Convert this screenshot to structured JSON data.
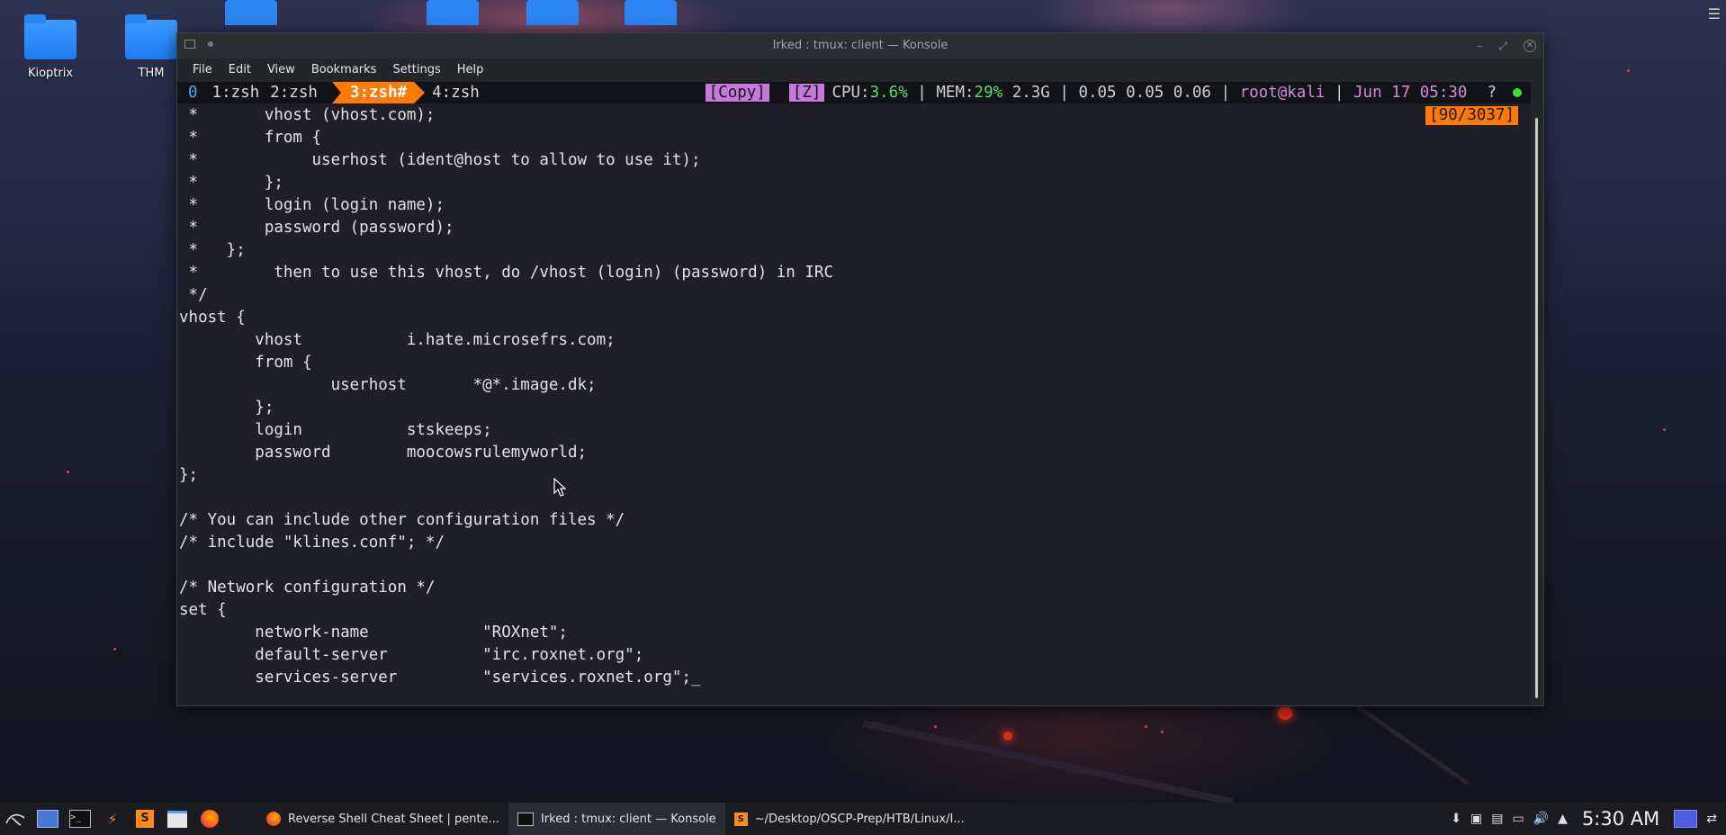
{
  "desktop": {
    "icons": [
      {
        "label": "Kioptrix"
      },
      {
        "label": "THM"
      }
    ]
  },
  "window": {
    "title": "Irked : tmux: client — Konsole",
    "menu": [
      "File",
      "Edit",
      "View",
      "Bookmarks",
      "Settings",
      "Help"
    ]
  },
  "tmux": {
    "session": "0",
    "tabs": [
      "1:zsh",
      "2:zsh",
      "3:zsh#",
      "4:zsh"
    ],
    "active_tab_index": 2,
    "copy_mode": "[Copy]",
    "zoom": "[Z]",
    "cpu_label": "CPU:",
    "cpu": "3.6%",
    "mem_label": "MEM:",
    "mem": "29%",
    "mem_abs": "2.3G",
    "load": "0.05 0.05 0.06",
    "user": "root@kali",
    "datetime": "Jun 17 05:30",
    "help": "?",
    "position": "[90/3037]"
  },
  "terminal_lines": [
    " *       vhost (vhost.com);",
    " *       from {",
    " *            userhost (ident@host to allow to use it);",
    " *       };",
    " *       login (login name);",
    " *       password (password);",
    " *   };",
    " *        then to use this vhost, do /vhost (login) (password) in IRC",
    " */",
    "vhost {",
    "        vhost           i.hate.microsefrs.com;",
    "        from {",
    "                userhost       *@*.image.dk;",
    "        };",
    "        login           stskeeps;",
    "        password        moocowsrulemyworld;",
    "};",
    "",
    "/* You can include other configuration files */",
    "/* include \"klines.conf\"; */",
    "",
    "/* Network configuration */",
    "set {",
    "        network-name            \"ROXnet\";",
    "        default-server          \"irc.roxnet.org\";",
    "        services-server         \"services.roxnet.org\";_"
  ],
  "taskbar": {
    "tasks": [
      {
        "label": "Reverse Shell Cheat Sheet | pente..."
      },
      {
        "label": "Irked : tmux: client — Konsole"
      },
      {
        "label": "~/Desktop/OSCP-Prep/HTB/Linux/I..."
      }
    ],
    "clock": "5:30 AM"
  }
}
